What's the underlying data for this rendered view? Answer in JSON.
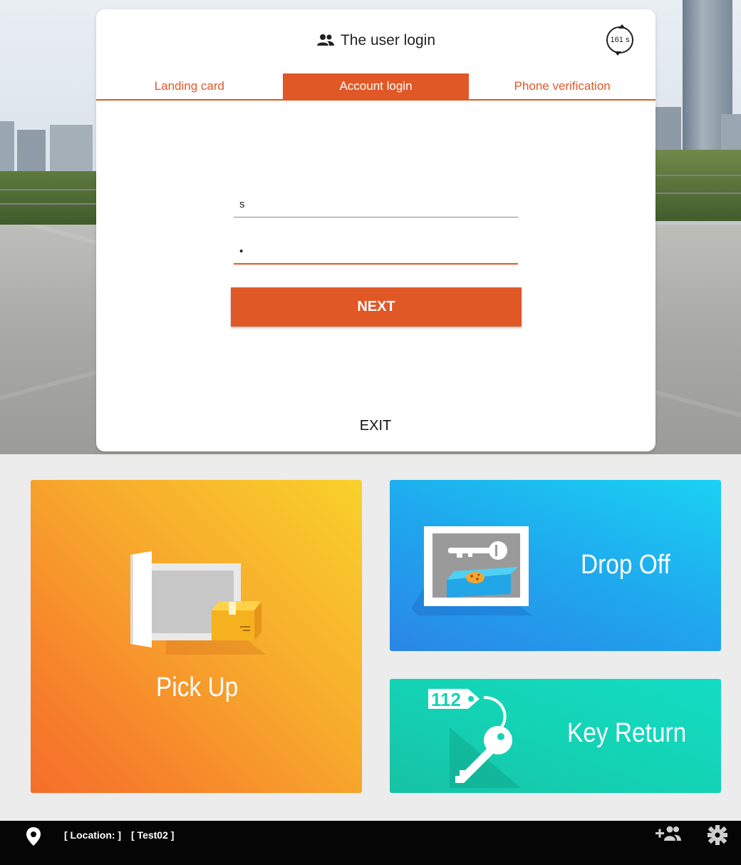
{
  "login": {
    "title": "The user login",
    "countdown": "161 s",
    "tabs": [
      {
        "label": "Landing card",
        "active": false
      },
      {
        "label": "Account login",
        "active": true
      },
      {
        "label": "Phone verification",
        "active": false
      }
    ],
    "username_value": "s",
    "password_value": "•",
    "next_label": "NEXT",
    "exit_label": "EXIT"
  },
  "tiles": {
    "pickup": {
      "label": "Pick Up"
    },
    "dropoff": {
      "label": "Drop Off"
    },
    "keyreturn": {
      "label": "Key Return",
      "tag_text": "112"
    }
  },
  "status_bar": {
    "location_label": "[ Location: ]",
    "device_label": "[ Test02 ]"
  },
  "colors": {
    "accent": "#e15827",
    "pickup": "#f7a92c",
    "dropoff": "#1fa8ee",
    "keyreturn": "#14d3b5"
  },
  "icons": {
    "header": "people-icon",
    "timer": "countdown-timer-icon",
    "location": "location-pin-icon",
    "add_user": "add-user-icon",
    "settings": "settings-icon"
  }
}
